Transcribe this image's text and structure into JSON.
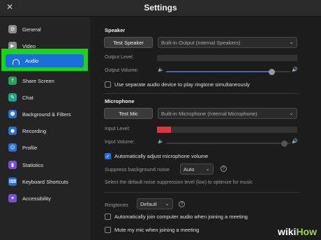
{
  "window": {
    "title": "Settings",
    "close_glyph": "✕"
  },
  "sidebar": {
    "items": [
      {
        "label": "General",
        "icon": "gear-icon",
        "color": "#8e8e8e",
        "glyph": "⚙"
      },
      {
        "label": "Video",
        "icon": "video-icon",
        "color": "#8e8e8e",
        "glyph": "▶"
      },
      {
        "label": "Audio",
        "icon": "headphones-icon",
        "color": "#1a6fd9",
        "glyph": ""
      },
      {
        "label": "Share Screen",
        "icon": "share-screen-icon",
        "color": "#27a35a",
        "glyph": "↑"
      },
      {
        "label": "Chat",
        "icon": "chat-icon",
        "color": "#1fa58a",
        "glyph": "✎"
      },
      {
        "label": "Background & Filters",
        "icon": "background-icon",
        "color": "#2b6fd6",
        "glyph": "☻"
      },
      {
        "label": "Recording",
        "icon": "recording-icon",
        "color": "#2b6fd6",
        "glyph": "●"
      },
      {
        "label": "Profile",
        "icon": "profile-icon",
        "color": "#2b6fd6",
        "glyph": "☺"
      },
      {
        "label": "Statistics",
        "icon": "statistics-icon",
        "color": "#7b4fd8",
        "glyph": "▮"
      },
      {
        "label": "Keyboard Shortcuts",
        "icon": "keyboard-icon",
        "color": "#2b6fd6",
        "glyph": "⌨"
      },
      {
        "label": "Accessibility",
        "icon": "accessibility-icon",
        "color": "#7b4fd8",
        "glyph": "✦"
      }
    ],
    "selected_index": 2,
    "highlight_color": "#19d41b"
  },
  "speaker": {
    "section_title": "Speaker",
    "test_button": "Test Speaker",
    "device": "Built-in Output (Internal Speakers)",
    "output_level_label": "Output Level:",
    "output_volume_label": "Output Volume:",
    "output_volume": 0.85,
    "separate_device_label": "Use separate audio device to play ringtone simultaneously",
    "separate_device_checked": false
  },
  "microphone": {
    "section_title": "Microphone",
    "test_button": "Test Mic",
    "device": "Built-in Microphone (Internal Microphone)",
    "input_level_label": "Input Level:",
    "input_level": 0.1,
    "input_volume_label": "Input Volume:",
    "input_volume": 0.95,
    "auto_adjust_label": "Automatically adjust microphone volume",
    "auto_adjust_checked": true,
    "suppress_label": "Suppress background noise",
    "suppress_value": "Auto",
    "suppress_hint": "Select the default noise suppression level (low) to optimize for music"
  },
  "ringtones": {
    "label": "Ringtones",
    "value": "Default"
  },
  "options": {
    "auto_join_label": "Automatically join computer audio when joining a meeting",
    "auto_join_checked": false,
    "mute_label": "Mute my mic when joining a meeting",
    "mute_checked": false
  },
  "watermark": {
    "part1": "wiki",
    "part2": "How"
  },
  "colors": {
    "accent": "#1a74e8",
    "level_red": "#d63a3a"
  }
}
